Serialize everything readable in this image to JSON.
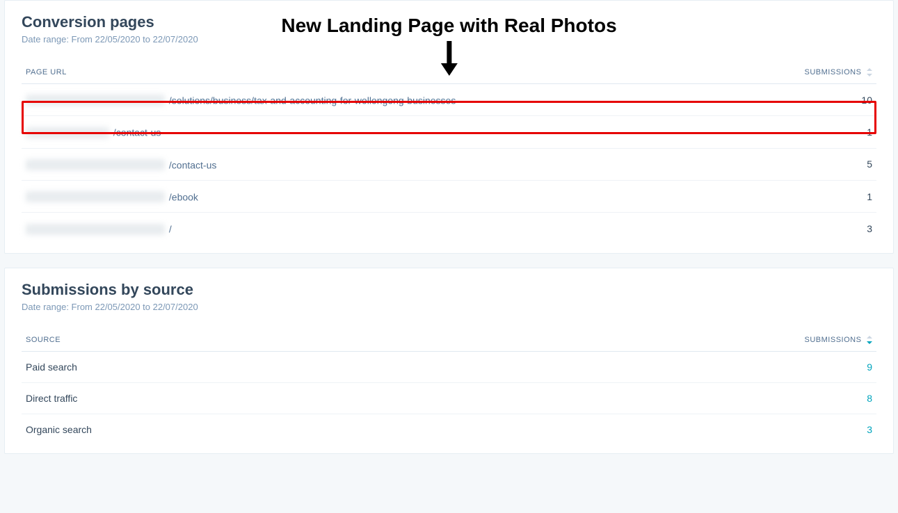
{
  "conversion_pages": {
    "title": "Conversion pages",
    "date_range": "Date range: From 22/05/2020 to 22/07/2020",
    "columns": {
      "url": "PAGE URL",
      "submissions": "SUBMISSIONS"
    },
    "rows": [
      {
        "redacted_w": 200,
        "path": "/solutions/business/tax-and-accounting-for-wollongong-businesses",
        "submissions": "10"
      },
      {
        "redacted_w": 120,
        "path": "/contact-us",
        "submissions": "1"
      },
      {
        "redacted_w": 200,
        "path": "/contact-us",
        "submissions": "5"
      },
      {
        "redacted_w": 200,
        "path": "/ebook",
        "submissions": "1"
      },
      {
        "redacted_w": 200,
        "path": "/",
        "submissions": "3"
      }
    ]
  },
  "submissions_by_source": {
    "title": "Submissions by source",
    "date_range": "Date range: From 22/05/2020 to 22/07/2020",
    "columns": {
      "source": "SOURCE",
      "submissions": "SUBMISSIONS"
    },
    "rows": [
      {
        "source": "Paid search",
        "submissions": "9"
      },
      {
        "source": "Direct traffic",
        "submissions": "8"
      },
      {
        "source": "Organic search",
        "submissions": "3"
      }
    ]
  },
  "annotation": {
    "label": "New Landing Page with Real Photos"
  },
  "colors": {
    "accent": "#00a4bd",
    "highlight": "#e60000"
  }
}
